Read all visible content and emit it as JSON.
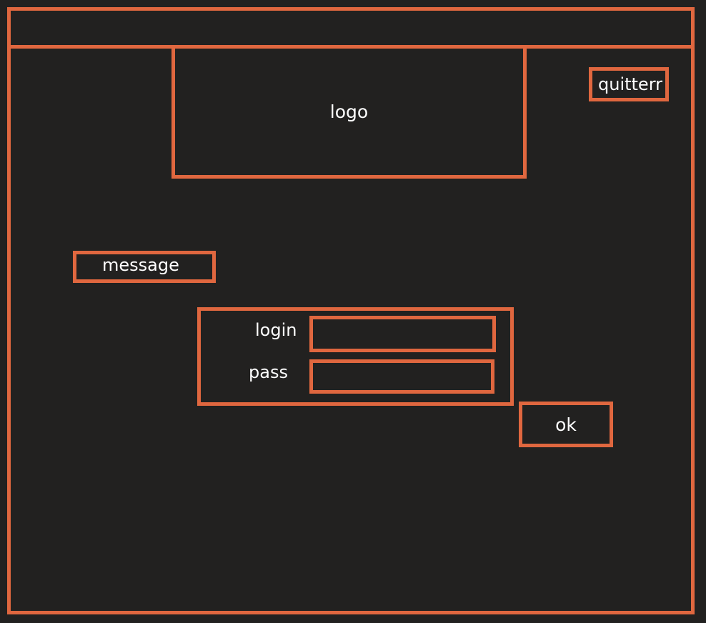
{
  "header": {
    "logo_text": "logo",
    "quit_label": "quitterr"
  },
  "message": {
    "text": "message"
  },
  "form": {
    "login_label": "login",
    "login_value": "",
    "pass_label": "pass",
    "pass_value": "",
    "ok_label": "ok"
  },
  "colors": {
    "background": "#222120",
    "outline": "#e0673f",
    "text": "#ffffff"
  }
}
